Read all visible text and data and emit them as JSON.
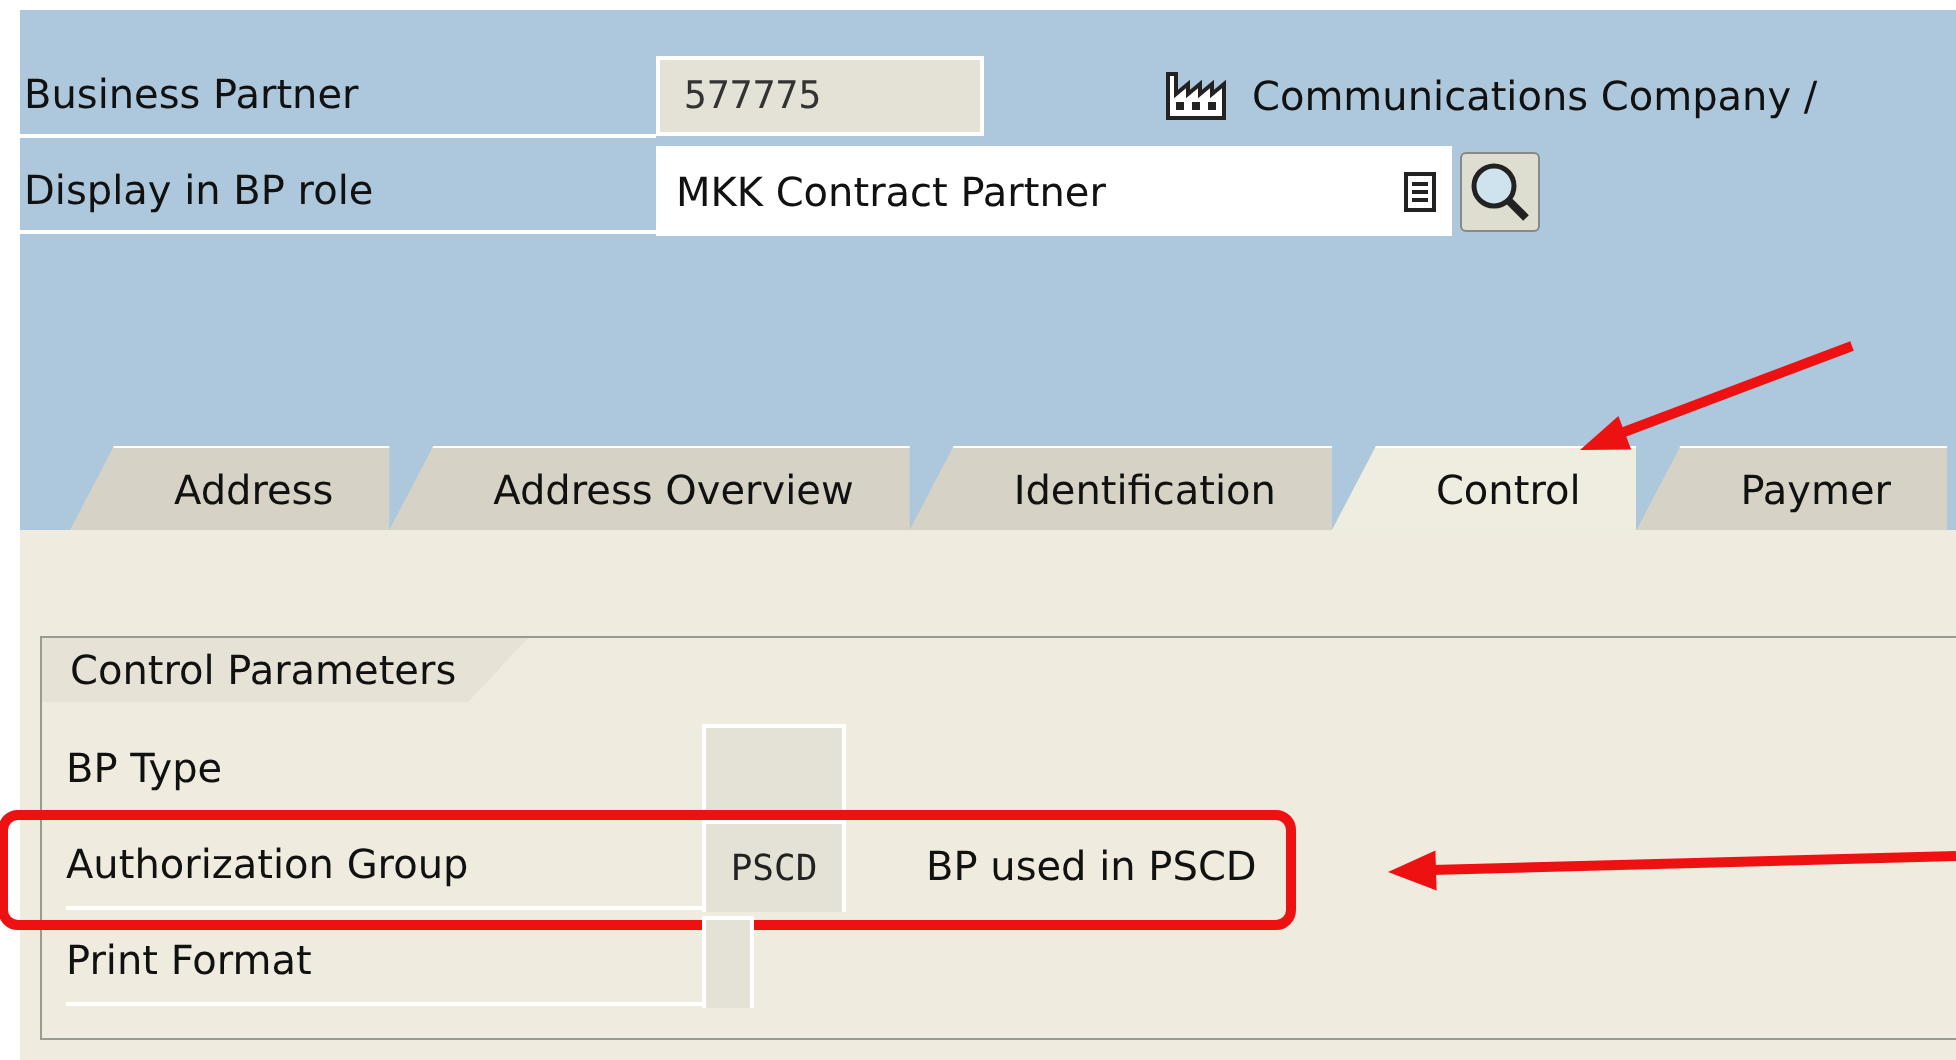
{
  "header": {
    "fields": [
      {
        "label": "Business Partner",
        "value": "577775",
        "kind": "readonly",
        "partner_name": "Communications Company / "
      },
      {
        "label": "Display in BP role",
        "value": "MKK Contract Partner",
        "kind": "dropdown"
      }
    ]
  },
  "tabs": [
    {
      "label": "Address",
      "selected": false,
      "callout": false
    },
    {
      "label": "Address Overview",
      "selected": false,
      "callout": false
    },
    {
      "label": "Identification",
      "selected": false,
      "callout": false
    },
    {
      "label": "Control",
      "selected": true,
      "callout": true
    },
    {
      "label": "Paymer",
      "selected": false,
      "callout": false
    }
  ],
  "group": {
    "title": "Control Parameters",
    "rows": [
      {
        "label": "BP Type",
        "value": "",
        "kind": "wide",
        "description": "",
        "highlighted": false
      },
      {
        "label": "Authorization Group",
        "value": "PSCD",
        "kind": "wide",
        "description": "BP used in PSCD",
        "highlighted": true
      },
      {
        "label": "Print Format",
        "value": "",
        "kind": "narrow",
        "description": "",
        "highlighted": false
      }
    ]
  }
}
